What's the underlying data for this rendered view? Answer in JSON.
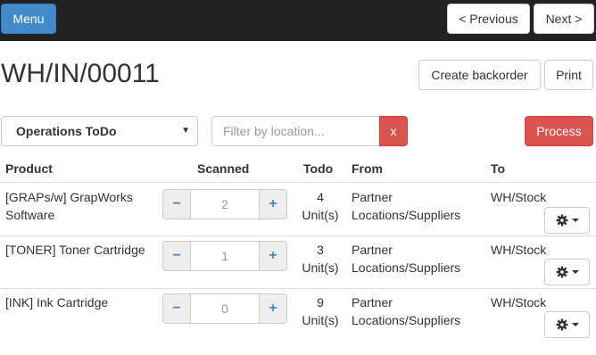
{
  "topbar": {
    "menu_label": "Menu",
    "previous_label": "< Previous",
    "next_label": "Next >"
  },
  "page": {
    "title": "WH/IN/00011",
    "create_backorder_label": "Create backorder",
    "print_label": "Print"
  },
  "filters": {
    "operations_select": "Operations ToDo",
    "location_placeholder": "Filter by location...",
    "clear_label": "x",
    "process_label": "Process"
  },
  "table": {
    "headers": {
      "product": "Product",
      "scanned": "Scanned",
      "todo": "Todo",
      "from": "From",
      "to": "To"
    },
    "rows": [
      {
        "product": "[GRAPs/w] GrapWorks Software",
        "scanned": "2",
        "todo_qty": "4",
        "todo_unit": "Unit(s)",
        "from": "Partner Locations/Suppliers",
        "to": "WH/Stock"
      },
      {
        "product": "[TONER] Toner Cartridge",
        "scanned": "1",
        "todo_qty": "3",
        "todo_unit": "Unit(s)",
        "from": "Partner Locations/Suppliers",
        "to": "WH/Stock"
      },
      {
        "product": "[INK] Ink Cartridge",
        "scanned": "0",
        "todo_qty": "9",
        "todo_unit": "Unit(s)",
        "from": "Partner Locations/Suppliers",
        "to": "WH/Stock"
      }
    ],
    "stepper_minus": "−",
    "stepper_plus": "+"
  },
  "colors": {
    "topbar_bg": "#222222",
    "primary": "#428bca",
    "danger": "#d9534f"
  }
}
